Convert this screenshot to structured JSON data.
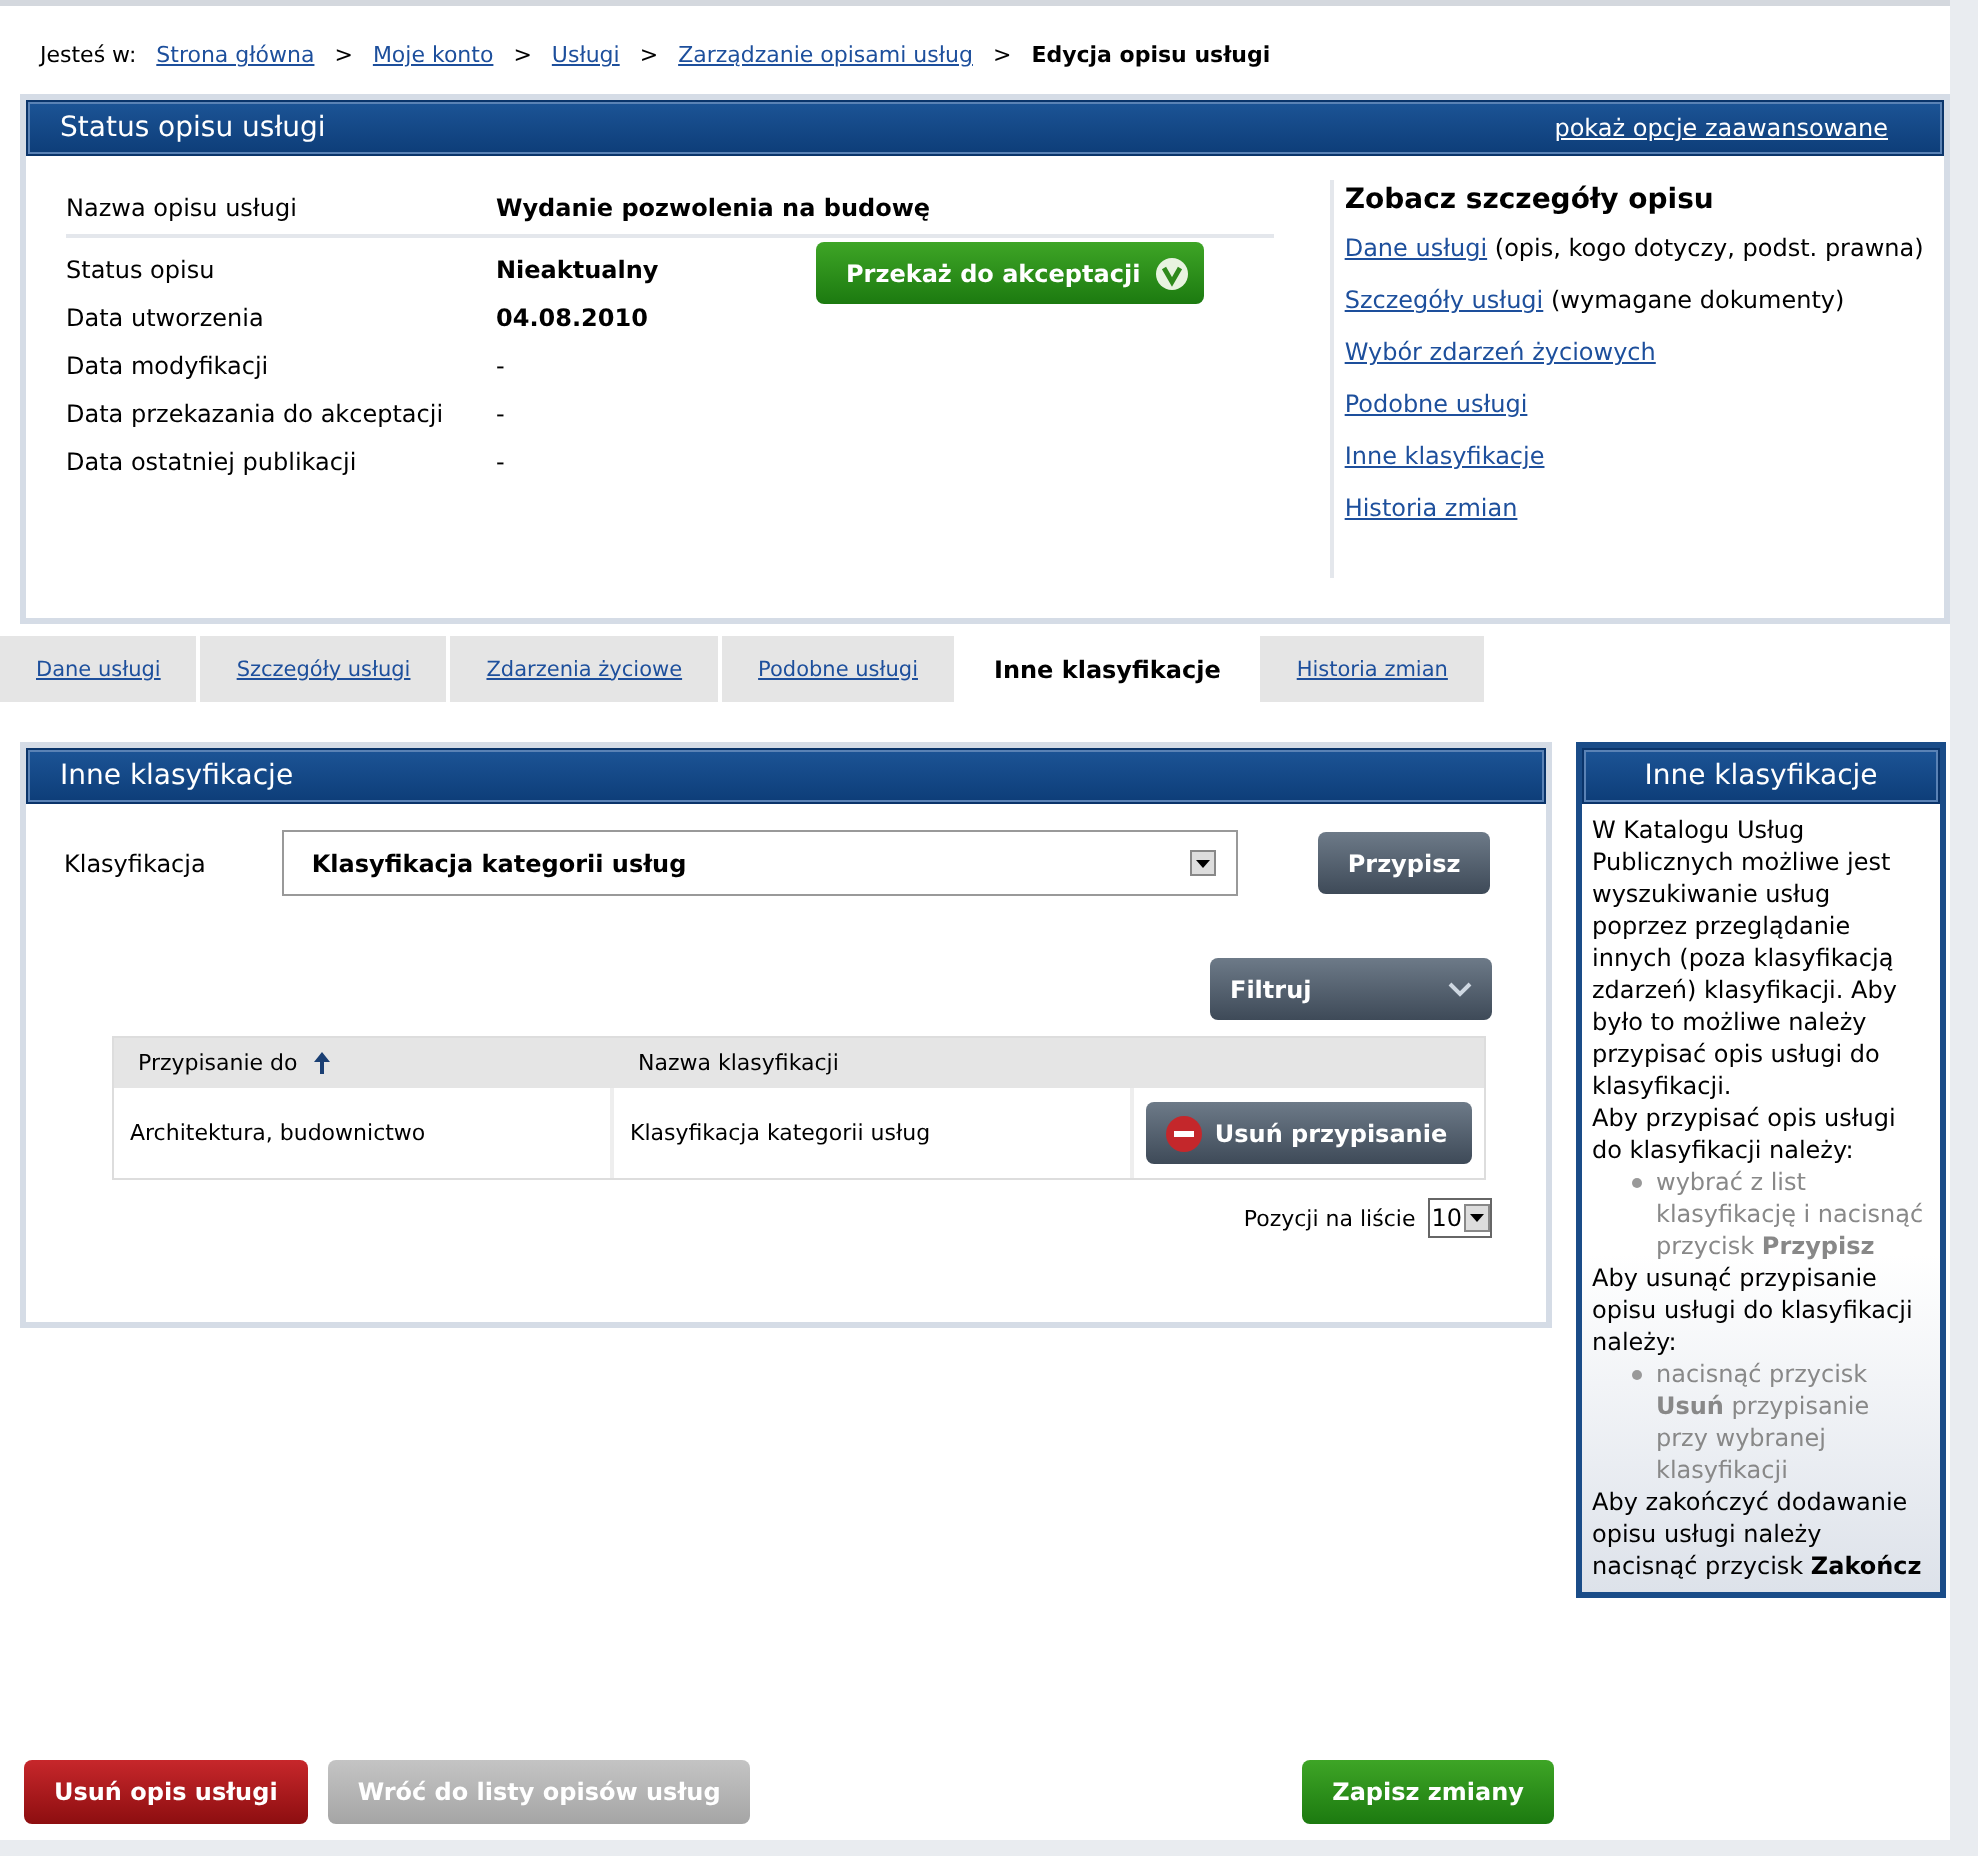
{
  "breadcrumb": {
    "label": "Jesteś w:",
    "links": [
      "Strona główna",
      "Moje konto",
      "Usługi",
      "Zarządzanie opisami usług"
    ],
    "separator": ">",
    "current": "Edycja opisu usługi"
  },
  "status_panel": {
    "title": "Status opisu usługi",
    "advanced_link": "pokaż opcje zaawansowane",
    "name_row": {
      "label": "Nazwa opisu usługi",
      "value": "Wydanie pozwolenia na budowę"
    },
    "rows": [
      {
        "label": "Status opisu",
        "value": "Nieaktualny"
      },
      {
        "label": "Data utworzenia",
        "value": "04.08.2010"
      },
      {
        "label": "Data modyfikacji",
        "value": "-"
      },
      {
        "label": "Data przekazania do akceptacji",
        "value": "-"
      },
      {
        "label": "Data ostatniej publikacji",
        "value": "-"
      }
    ],
    "submit_button": "Przekaż do akceptacji",
    "details": {
      "title": "Zobacz szczegóły opisu",
      "links": [
        {
          "link": "Dane usługi",
          "note": "(opis, kogo dotyczy, podst. prawna)"
        },
        {
          "link": "Szczegóły usługi",
          "note": "(wymagane dokumenty)"
        },
        {
          "link": "Wybór zdarzeń życiowych"
        },
        {
          "link": "Podobne usługi"
        },
        {
          "link": "Inne klasyfikacje"
        },
        {
          "link": "Historia zmian"
        }
      ]
    }
  },
  "tabs": [
    {
      "label": "Dane usługi",
      "selected": false
    },
    {
      "label": "Szczegóły usługi",
      "selected": false
    },
    {
      "label": "Zdarzenia życiowe",
      "selected": false
    },
    {
      "label": "Podobne usługi",
      "selected": false
    },
    {
      "label": "Inne klasyfikacje",
      "selected": true
    },
    {
      "label": "Historia zmian",
      "selected": false
    }
  ],
  "classifications_panel": {
    "title": "Inne klasyfikacje",
    "field_label": "Klasyfikacja",
    "field_value": "Klasyfikacja kategorii usług",
    "assign_button": "Przypisz",
    "filter_button": "Filtruj",
    "table": {
      "columns": [
        {
          "label": "Przypisanie do",
          "sorted": true
        },
        {
          "label": "Nazwa klasyfikacji",
          "sorted": false
        }
      ],
      "rows": [
        {
          "cells": [
            "Architektura, budownictwo",
            "Klasyfikacja kategorii usług"
          ],
          "action": "Usuń przypisanie"
        }
      ]
    },
    "page_size_label": "Pozycji na liście",
    "page_size": "10"
  },
  "help_panel": {
    "title": "Inne klasyfikacje",
    "blocks": [
      {
        "kind": "paragraph",
        "text": "W Katalogu Usług Publicznych możliwe jest wyszukiwanie usług poprzez przeglądanie innych (poza klasyfikacją zdarzeń) klasyfikacji. Aby było to możliwe należy przypisać opis usługi do klasyfikacji."
      },
      {
        "kind": "paragraph",
        "text": "Aby przypisać opis usługi do klasyfikacji należy:"
      },
      {
        "kind": "bullet",
        "text": "wybrać z list klasyfikację i nacisnąć przycisk **Przypisz**"
      },
      {
        "kind": "paragraph",
        "text": "Aby usunąć przypisanie opisu usługi do klasyfikacji należy:"
      },
      {
        "kind": "bullet",
        "text": "nacisnąć przycisk **Usuń** przypisanie przy wybranej klasyfikacji"
      },
      {
        "kind": "paragraph",
        "text": "Aby zakończyć dodawanie opisu usługi należy nacisnąć przycisk **Zakończ**"
      }
    ]
  },
  "footer_buttons": [
    {
      "label": "Usuń opis usługi",
      "kind": "danger"
    },
    {
      "label": "Wróć do listy opisów usług",
      "kind": "secondary"
    },
    {
      "label": "Zapisz zmiany",
      "kind": "primary"
    }
  ]
}
